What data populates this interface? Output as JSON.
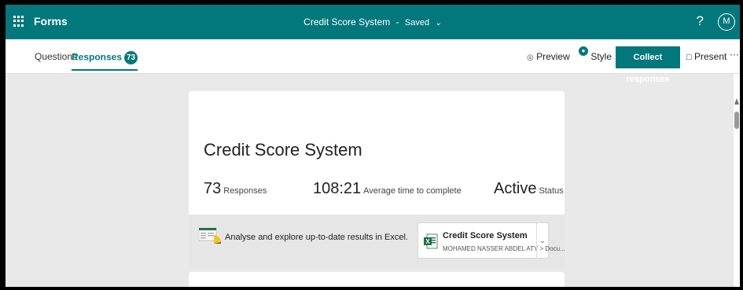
{
  "topbar": {
    "app_name": "Forms",
    "form_title": "Credit Score System",
    "separator": "-",
    "save_status": "Saved",
    "help_label": "?",
    "avatar_initial": "M"
  },
  "nav": {
    "tabs": [
      {
        "label": "Questions"
      },
      {
        "label": "Responses",
        "badge": "73"
      }
    ],
    "preview_label": "Preview",
    "style_label": "Style",
    "collect_label": "Collect responses",
    "present_label": "Present",
    "more_label": "···"
  },
  "summary": {
    "title": "Credit Score System",
    "responses_value": "73",
    "responses_label": "Responses",
    "avg_time_value": "108:21",
    "avg_time_label": "Average time to complete",
    "status_value": "Active",
    "status_label": "Status"
  },
  "excel": {
    "prompt": "Analyse and explore up-to-date results in Excel.",
    "file_name": "Credit Score System",
    "file_path": "MOHAMED NASSER ABDEL ATY > Docu..."
  },
  "colors": {
    "brand": "#03787c",
    "excel_green": "#1e7145"
  }
}
